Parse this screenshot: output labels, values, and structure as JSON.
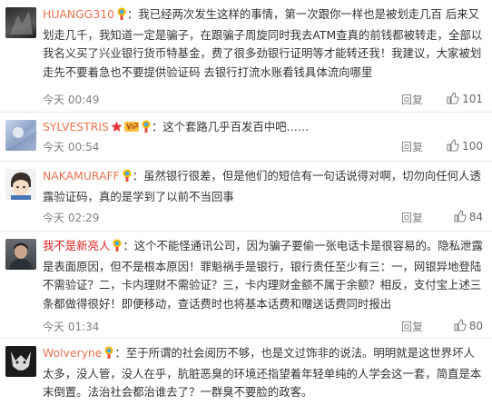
{
  "colors": {
    "username": "#eb7350",
    "username_red": "#e02020",
    "text": "#333333",
    "meta": "#808080",
    "divider": "#e8e8e8"
  },
  "icons": {
    "badge": "rainbow-badge-icon",
    "like": "thumbs-up-icon",
    "star": "star-icon",
    "vip": "vip-level-icon"
  },
  "comments": [
    {
      "user": "HUANGG310",
      "text": "：我已经两次发生这样的事情，第一次跟你一样也是被划走几百 后来又划走几千，我知道一定是骗子，在跟骗子周旋同时我去ATM查真的前钱都被转走，全部以我名义买了兴业银行货币特基金，费了很多劲银行证明等才能转还我！我建议，大家被划走先不要着急也不要提供验证码 去银行打流水账看钱具体流向哪里",
      "time": "今天 00:49",
      "reply": "回复",
      "likes": "101"
    },
    {
      "user": "SYLVESTRIS",
      "text": "：这个套路几乎百发百中吧……",
      "time": "今天 00:54",
      "reply": "回复",
      "likes": "100"
    },
    {
      "user": "NAKAMURAFF",
      "text": "：虽然银行很差，但是他们的短信有一句话说得对啊，切勿向任何人透露验证码，真的是学到了以前不当回事",
      "time": "今天 02:29",
      "reply": "回复",
      "likes": "84"
    },
    {
      "user": "我不是新亮人",
      "text": "：这个不能怪通讯公司，因为骗子要偷一张电话卡是很容易的。隐私泄露是表面原因，但不是根本原因！罪魁祸手是银行，银行责任至少有三：一，网银异地登陆不需验证？二，卡内理财不需验证？三，卡内理财金额不属于余额？相反，支付宝上述三条都做得很好！即便移动，查话费时也将基本话费和赠送话费同时报出",
      "time": "今天 01:34",
      "reply": "回复",
      "likes": "80"
    },
    {
      "user": "Wolveryne",
      "text": "：至于所谓的社会阅历不够，也是文过饰非的说法。明明就是这世界坏人太多，没人管，没人在乎，肮脏恶臭的环境还指望着年轻单纯的人学会这一套，简直是本末倒置。法治社会都治谁去了？一群臭不要脸的政客。",
      "time": "",
      "reply": "",
      "likes": ""
    }
  ]
}
